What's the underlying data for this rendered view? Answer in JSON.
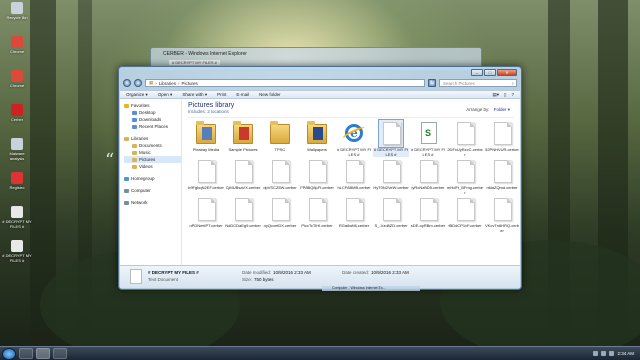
{
  "desktop": {
    "icons": [
      {
        "label": "Recycle Bin",
        "color": "#c9d2dc"
      },
      {
        "label": "Chrome",
        "color": "#d94a3a"
      },
      {
        "label": "Chrome",
        "color": "#d94a3a"
      },
      {
        "label": "Cerber",
        "color": "#c22"
      },
      {
        "label": "Malware analysis",
        "color": "#c9d2dc"
      },
      {
        "label": "Registro",
        "color": "#d33"
      },
      {
        "label": "# DECRYPT MY FILES #",
        "color": "#e8e8e8"
      },
      {
        "label": "# DECRYPT MY FILES #",
        "color": "#e8e8e8"
      }
    ]
  },
  "ie_window": {
    "title": "CERBER - Windows Internet Explorer",
    "tab": "# DECRYPT MY FILES #"
  },
  "explorer": {
    "address": [
      "Libraries",
      "Pictures"
    ],
    "search_placeholder": "Search Pictures",
    "toolbar": {
      "organize": "Organize ▾",
      "open": "Open ▾",
      "share": "Share with ▾",
      "print": "Print",
      "email": "E-mail",
      "new_folder": "New folder"
    },
    "nav": [
      {
        "label": "Favorites",
        "level": 0,
        "color": "#f2b21b"
      },
      {
        "label": "Desktop",
        "level": 1,
        "color": "#5a8fd0"
      },
      {
        "label": "Downloads",
        "level": 1,
        "color": "#5a8fd0"
      },
      {
        "label": "Recent Places",
        "level": 1,
        "color": "#5a8fd0"
      },
      {
        "gap": true
      },
      {
        "label": "Libraries",
        "level": 0,
        "color": "#d8b35a"
      },
      {
        "label": "Documents",
        "level": 1,
        "color": "#d8b35a"
      },
      {
        "label": "Music",
        "level": 1,
        "color": "#d8b35a"
      },
      {
        "label": "Pictures",
        "level": 1,
        "color": "#d8b35a",
        "selected": true
      },
      {
        "label": "Videos",
        "level": 1,
        "color": "#d8b35a"
      },
      {
        "gap": true
      },
      {
        "label": "Homegroup",
        "level": 0,
        "color": "#4a9ad8"
      },
      {
        "gap": true
      },
      {
        "label": "Computer",
        "level": 0,
        "color": "#7a8ca0"
      },
      {
        "gap": true
      },
      {
        "label": "Network",
        "level": 0,
        "color": "#7a8ca0"
      }
    ],
    "library_title": "Pictures library",
    "library_sub": "Includes: 2 locations",
    "arrange_by_label": "Arrange by:",
    "arrange_by_value": "Folder ▾",
    "files": [
      {
        "name": "Pixabay Media",
        "kind": "folder",
        "color": "#5a7fb8"
      },
      {
        "name": "Sample Pictures",
        "kind": "folder",
        "color": "#c83a2a"
      },
      {
        "name": "TPSC",
        "kind": "folder",
        "color": ""
      },
      {
        "name": "Wallpapers",
        "kind": "folder",
        "color": "#2a4a8a"
      },
      {
        "name": "# DECRYPT MY FILES #",
        "kind": "ie"
      },
      {
        "name": "# DECRYPT MY FILES #",
        "kind": "doc",
        "selected": true
      },
      {
        "name": "# DECRYPT MY FILES #",
        "kind": "notepad"
      },
      {
        "name": "2DFxUyRzcC.cerber",
        "kind": "doc"
      },
      {
        "name": "52PNHVUR.cerber",
        "kind": "doc"
      },
      {
        "name": "b9FgbqN2EF.cerber",
        "kind": "doc"
      },
      {
        "name": "CjMUBsaVX.cerber",
        "kind": "doc"
      },
      {
        "name": "dpVSCZ5W.cerber",
        "kind": "doc"
      },
      {
        "name": "FP8BQ8pFt.cerber",
        "kind": "doc"
      },
      {
        "name": "hLCF8BMB.cerber",
        "kind": "doc"
      },
      {
        "name": "HyT0N2VeW.cerber",
        "kind": "doc"
      },
      {
        "name": "iyRcNzBD5.cerber",
        "kind": "doc"
      },
      {
        "name": "mHdFt_BFmg.cerber",
        "kind": "doc"
      },
      {
        "name": "n6laZQmd.cerber",
        "kind": "doc"
      },
      {
        "name": "nPDNeelPT.cerber",
        "kind": "doc"
      },
      {
        "name": "NdDCDaEg9.cerber",
        "kind": "doc"
      },
      {
        "name": "nyQcvetDX.cerber",
        "kind": "doc"
      },
      {
        "name": "PiccTcTlHI.cerber",
        "kind": "doc"
      },
      {
        "name": "RGa6wMLcerber",
        "kind": "doc"
      },
      {
        "name": "S_-Vzd8ZD.cerber",
        "kind": "doc"
      },
      {
        "name": "sDE-oyRBm.cerber",
        "kind": "doc"
      },
      {
        "name": "tBDdCP1vF.cerber",
        "kind": "doc"
      },
      {
        "name": "VKcvTn6HRQ.cerber",
        "kind": "doc"
      }
    ],
    "details": {
      "name": "# DECRYPT MY FILES #",
      "type": "Text Document",
      "date_modified_label": "Date modified:",
      "date_modified": "10/9/2016 2:33 AM",
      "date_created_label": "Date created:",
      "date_created": "10/9/2016 2:33 AM",
      "size_label": "Size:",
      "size": "750 bytes"
    }
  },
  "taskbar": {
    "hidden_window": "Computer - Windows Internet Ex...",
    "clock": "2:34 AM"
  }
}
